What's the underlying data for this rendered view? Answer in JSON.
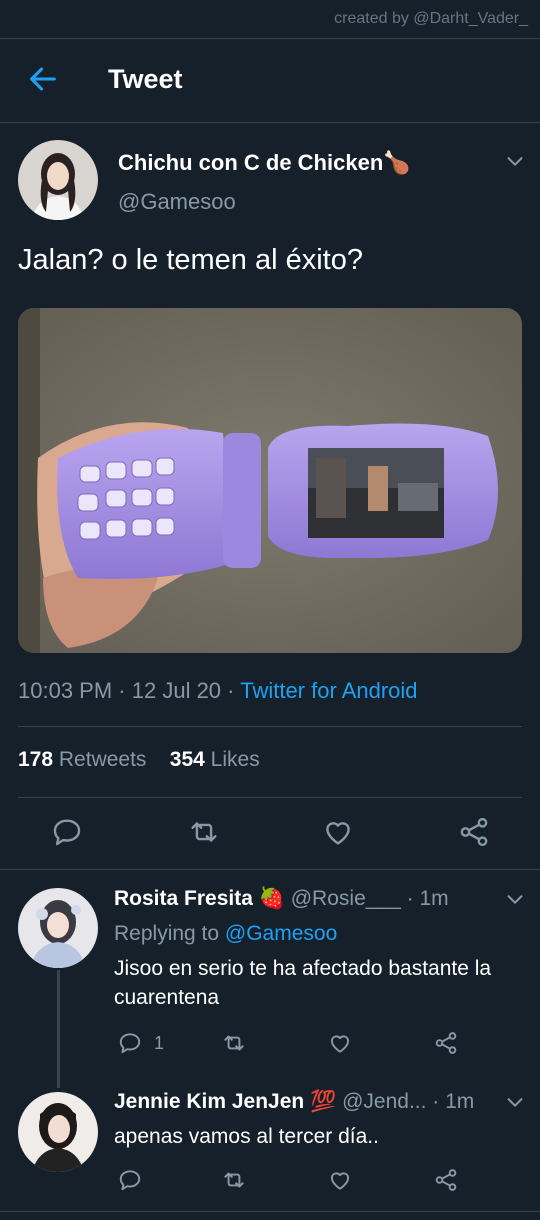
{
  "watermark": "created by @Darht_Vader_",
  "header": {
    "title": "Tweet"
  },
  "tweet": {
    "author_name": "Chichu con C de Chicken",
    "author_emoji": "🍗",
    "handle": "@Gamesoo",
    "text": "Jalan? o le temen al éxito?",
    "time": "10:03 PM",
    "date": "12 Jul 20",
    "sep": "·",
    "source": "Twitter for Android",
    "retweets_count": "178",
    "retweets_label": "Retweets",
    "likes_count": "354",
    "likes_label": "Likes"
  },
  "replies": [
    {
      "name": "Rosita Fresita",
      "emoji": "🍓",
      "handle": "@Rosie___",
      "time": "· 1m",
      "replying_label": "Replying to",
      "replying_to": "@Gamesoo",
      "text": "Jisoo en serio te ha afectado bastante la cuarentena",
      "reply_count": "1"
    },
    {
      "name": "Jennie Kim JenJen",
      "emoji": "💯",
      "handle": "@Jend...",
      "time": "· 1m",
      "text": "apenas vamos al tercer día.."
    }
  ],
  "colors": {
    "background": "#15202b",
    "accent": "#1da1f2",
    "muted": "#8899a6",
    "divider": "#38444d"
  }
}
